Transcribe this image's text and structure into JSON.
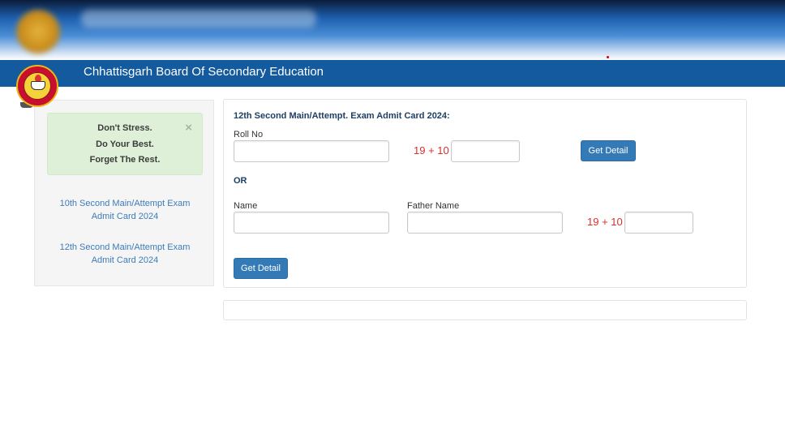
{
  "header": {
    "title": "Chhattisgarh Board Of Secondary Education",
    "bar_color": "#145a9e",
    "logo": "cgbse-seal-logo"
  },
  "sidebar": {
    "alert": {
      "lines": [
        "Don't Stress.",
        "Do Your Best.",
        "Forget The Rest."
      ],
      "close_glyph": "×"
    },
    "links": [
      {
        "label": "10th Second Main/Attempt Exam Admit Card 2024"
      },
      {
        "label": "12th Second Main/Attempt Exam Admit Card 2024"
      }
    ]
  },
  "form": {
    "title": "12th Second Main/Attempt. Exam Admit Card 2024:",
    "roll_no_label": "Roll No",
    "roll_no_value": "",
    "captcha_1": "19 + 10",
    "captcha_1_answer": "",
    "get_detail_1": "Get Detail",
    "or_label": "OR",
    "name_label": "Name",
    "name_value": "",
    "father_name_label": "Father Name",
    "father_name_value": "",
    "captcha_2": "19 + 10",
    "captcha_2_answer": "",
    "get_detail_2": "Get Detail"
  },
  "colors": {
    "primary_button": "#337ab7",
    "captcha_text": "#d9302c",
    "link": "#3e7bb8",
    "alert_bg": "#dff0d8"
  }
}
